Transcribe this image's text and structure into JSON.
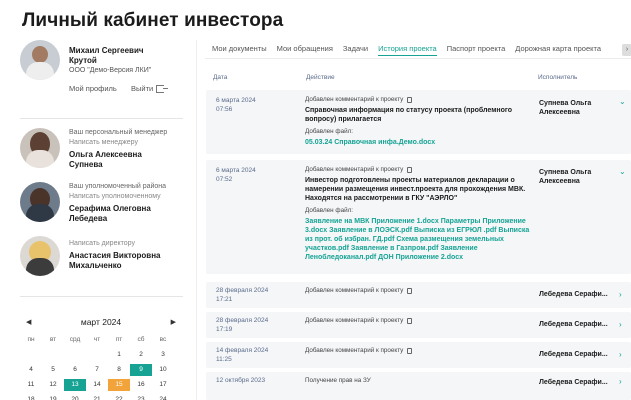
{
  "page_title": "Личный кабинет инвестора",
  "user": {
    "name": "Михаил Сергеевич Крутой",
    "org": "ООО \"Демо-Версия ЛКИ\"",
    "profile_link": "Мой профиль",
    "logout_link": "Выйти"
  },
  "contacts": [
    {
      "role": "Ваш персональный менеджер",
      "action": "Написать менеджеру",
      "name": "Ольга Алексеевна Супнева"
    },
    {
      "role": "Ваш уполномоченный района",
      "action": "Написать уполномоченному",
      "name": "Серафима Олеговна Лебедева"
    },
    {
      "role": "",
      "action": "Написать директору",
      "name": "Анастасия Викторовна Михальченко"
    }
  ],
  "calendar": {
    "month": "март 2024",
    "prev": "◀",
    "next": "▶",
    "weekdays": [
      "пн",
      "вт",
      "срд",
      "чт",
      "пт",
      "сб",
      "вс"
    ],
    "days": [
      "",
      "",
      "",
      "",
      "1",
      "2",
      "3",
      "4",
      "5",
      "6",
      "7",
      "8",
      "9",
      "10",
      "11",
      "12",
      "13",
      "14",
      "15",
      "16",
      "17",
      "18",
      "19",
      "20",
      "21",
      "22",
      "23",
      "24"
    ]
  },
  "tabs": [
    "Мои документы",
    "Мои обращения",
    "Задачи",
    "История проекта",
    "Паспорт проекта",
    "Дорожная карта проекта"
  ],
  "active_tab": "История проекта",
  "table": {
    "headers": {
      "date": "Дата",
      "action": "Действие",
      "executor": "Исполнитель"
    },
    "rows": [
      {
        "date": "6 марта 2024",
        "time": "07:56",
        "action_small": "Добавлен комментарий к проекту",
        "action_bold": "Справочная информация по статусу проекта (проблемного вопросу) прилагается",
        "file_label": "Добавлен файл:",
        "files": "05.03.24 Справочная инфа.Демо.docx",
        "executor": "Супнева Ольга Алексеевна",
        "chevron": "⌄"
      },
      {
        "date": "6 марта 2024",
        "time": "07:52",
        "action_small": "Добавлен комментарий к проекту",
        "action_bold": "Инвестор подготовлены проекты материалов декларации о намерении размещения инвест.проекта для прохождения МВК.",
        "action_bold2": "Находятся на рассмотрении в ГКУ \"АЭРЛО\"",
        "file_label": "Добавлен файл:",
        "files": "Заявление на МВК Приложение 1.docx Параметры Приложение 3.docx Заявление в ЛОЭСК.pdf Выписка из ЕГРЮЛ .pdf Выписка из прот. об избран. ГД.pdf Схема размещения земельных участков.pdf Заявление в Газпром.pdf Заявление Ленобледоканал.pdf ДОН Приложение 2.docx",
        "executor": "Супнева Ольга Алексеевна",
        "chevron": "⌄"
      },
      {
        "date": "28 февраля 2024",
        "time": "17:21",
        "action_small": "Добавлен комментарий к проекту",
        "executor": "Лебедева Серафи...",
        "chevron": "›"
      },
      {
        "date": "28 февраля 2024",
        "time": "17:19",
        "action_small": "Добавлен комментарий к проекту",
        "executor": "Лебедева Серафи...",
        "chevron": "›"
      },
      {
        "date": "14 февраля 2024",
        "time": "11:25",
        "action_small": "Добавлен комментарий к проекту",
        "executor": "Лебедева Серафи...",
        "chevron": "›"
      },
      {
        "date": "12 октября 2023",
        "time": "",
        "action_small": "Получение прав на ЗУ",
        "executor": "Лебедева Серафи...",
        "chevron": "›"
      }
    ]
  },
  "colors": {
    "accent": "#16a394",
    "highlight": "#f2a33a",
    "row_bg": "#f4f6f8"
  }
}
